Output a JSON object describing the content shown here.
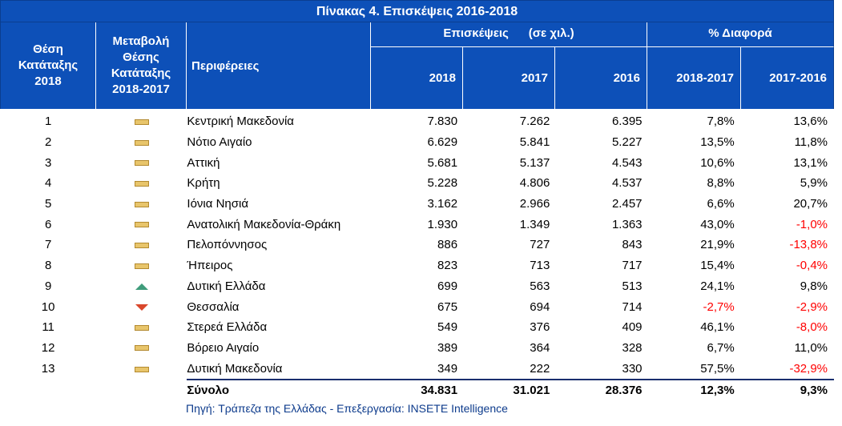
{
  "title": "Πίνακας 4. Επισκέψεις  2016-2018",
  "headers": {
    "rank": [
      "Θέση",
      "Κατάταξης",
      "2018"
    ],
    "change": [
      "Μεταβολή",
      "Θέσης",
      "Κατάταξης",
      "2018-2017"
    ],
    "region": "Περιφέρειες",
    "visits_group": "Επισκέψεις      (σε χιλ.)",
    "pct_group": "% Διαφορά",
    "y2018": "2018",
    "y2017": "2017",
    "y2016": "2016",
    "d1817": "2018-2017",
    "d1716": "2017-2016"
  },
  "rows": [
    {
      "rank": "1",
      "trend": "flat",
      "region": "Κεντρική Μακεδονία",
      "v2018": "7.830",
      "v2017": "7.262",
      "v2016": "6.395",
      "d1817": "7,8%",
      "d1716": "13,6%",
      "n1817": false,
      "n1716": false
    },
    {
      "rank": "2",
      "trend": "flat",
      "region": "Νότιο Αιγαίο",
      "v2018": "6.629",
      "v2017": "5.841",
      "v2016": "5.227",
      "d1817": "13,5%",
      "d1716": "11,8%",
      "n1817": false,
      "n1716": false
    },
    {
      "rank": "3",
      "trend": "flat",
      "region": "Αττική",
      "v2018": "5.681",
      "v2017": "5.137",
      "v2016": "4.543",
      "d1817": "10,6%",
      "d1716": "13,1%",
      "n1817": false,
      "n1716": false
    },
    {
      "rank": "4",
      "trend": "flat",
      "region": "Κρήτη",
      "v2018": "5.228",
      "v2017": "4.806",
      "v2016": "4.537",
      "d1817": "8,8%",
      "d1716": "5,9%",
      "n1817": false,
      "n1716": false
    },
    {
      "rank": "5",
      "trend": "flat",
      "region": "Ιόνια Νησιά",
      "v2018": "3.162",
      "v2017": "2.966",
      "v2016": "2.457",
      "d1817": "6,6%",
      "d1716": "20,7%",
      "n1817": false,
      "n1716": false
    },
    {
      "rank": "6",
      "trend": "flat",
      "region": "Ανατολική Μακεδονία-Θράκη",
      "v2018": "1.930",
      "v2017": "1.349",
      "v2016": "1.363",
      "d1817": "43,0%",
      "d1716": "-1,0%",
      "n1817": false,
      "n1716": true
    },
    {
      "rank": "7",
      "trend": "flat",
      "region": "Πελοπόννησος",
      "v2018": "886",
      "v2017": "727",
      "v2016": "843",
      "d1817": "21,9%",
      "d1716": "-13,8%",
      "n1817": false,
      "n1716": true
    },
    {
      "rank": "8",
      "trend": "flat",
      "region": "Ήπειρος",
      "v2018": "823",
      "v2017": "713",
      "v2016": "717",
      "d1817": "15,4%",
      "d1716": "-0,4%",
      "n1817": false,
      "n1716": true
    },
    {
      "rank": "9",
      "trend": "up",
      "region": "Δυτική Ελλάδα",
      "v2018": "699",
      "v2017": "563",
      "v2016": "513",
      "d1817": "24,1%",
      "d1716": "9,8%",
      "n1817": false,
      "n1716": false
    },
    {
      "rank": "10",
      "trend": "down",
      "region": "Θεσσαλία",
      "v2018": "675",
      "v2017": "694",
      "v2016": "714",
      "d1817": "-2,7%",
      "d1716": "-2,9%",
      "n1817": true,
      "n1716": true
    },
    {
      "rank": "11",
      "trend": "flat",
      "region": "Στερεά Ελλάδα",
      "v2018": "549",
      "v2017": "376",
      "v2016": "409",
      "d1817": "46,1%",
      "d1716": "-8,0%",
      "n1817": false,
      "n1716": true
    },
    {
      "rank": "12",
      "trend": "flat",
      "region": "Βόρειο Αιγαίο",
      "v2018": "389",
      "v2017": "364",
      "v2016": "328",
      "d1817": "6,7%",
      "d1716": "11,0%",
      "n1817": false,
      "n1716": false
    },
    {
      "rank": "13",
      "trend": "flat",
      "region": "Δυτική Μακεδονία",
      "v2018": "349",
      "v2017": "222",
      "v2016": "330",
      "d1817": "57,5%",
      "d1716": "-32,9%",
      "n1817": false,
      "n1716": true
    }
  ],
  "total": {
    "label": "Σύνολο",
    "v2018": "34.831",
    "v2017": "31.021",
    "v2016": "28.376",
    "d1817": "12,3%",
    "d1716": "9,3%"
  },
  "source": "Πηγή: Τράπεζα της Ελλάδας - Επεξεργασία: INSETE Intelligence",
  "colors": {
    "header_bg": "#0d50b8",
    "negative": "#ff0000",
    "flat_marker": "#e8c56b",
    "up_marker": "#3f9c7b",
    "down_marker": "#d9472b"
  },
  "trend_icons": {
    "flat": "no-change-dash-icon",
    "up": "up-triangle-icon",
    "down": "down-triangle-icon"
  }
}
